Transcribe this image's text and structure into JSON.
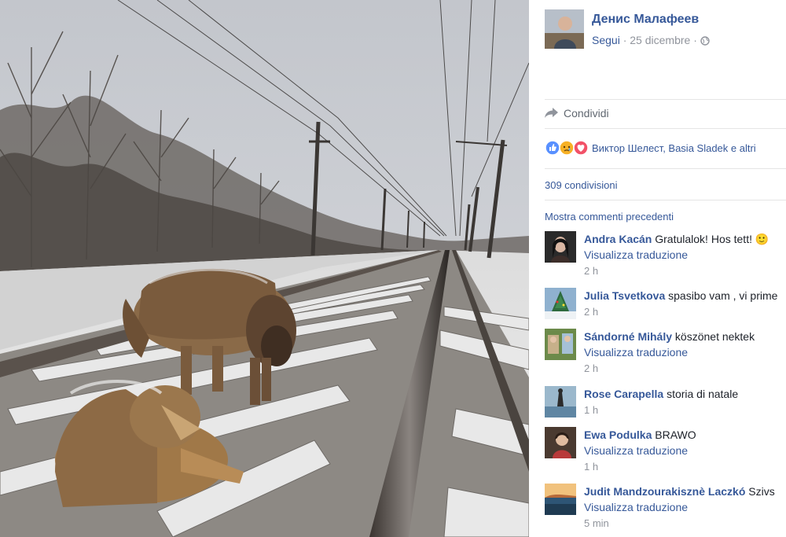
{
  "post": {
    "author_name": "Денис Малафеев",
    "follow_label": "Segui",
    "dot": "·",
    "date": "25 dicembre",
    "share_label": "Condividi",
    "reactions_text": "Виктор Шелест, Basia Sladek e altri",
    "shares_text": "309 condivisioni",
    "show_previous_comments": "Mostra commenti precedenti",
    "icons": {
      "globe": "globe-icon",
      "share": "share-arrow-icon",
      "like": "like-reaction-icon",
      "sad": "sad-reaction-icon",
      "love": "love-reaction-icon"
    }
  },
  "comments": [
    {
      "name": "Andra Kacán",
      "text": "Gratulalok! Hos tett! 🙂",
      "translate": "Visualizza traduzione",
      "time": "2 h"
    },
    {
      "name": "Julia Tsvetkova",
      "text": "spasibo vam , vi prime",
      "translate": "",
      "time": "2 h"
    },
    {
      "name": "Sándorné Mihály",
      "text": "köszönet nektek",
      "translate": "Visualizza traduzione",
      "time": "2 h"
    },
    {
      "name": "Rose Carapella",
      "text": "storia di natale",
      "translate": "",
      "time": "1 h"
    },
    {
      "name": "Ewa Podulka",
      "text": "BRAWO",
      "translate": "Visualizza traduzione",
      "time": "1 h"
    },
    {
      "name": "Judit Mandzourakisznè Laczkó",
      "text": "Szivs",
      "translate": "Visualizza traduzione",
      "time": "5 min"
    }
  ],
  "colors": {
    "link": "#365899",
    "meta": "#90949c",
    "text": "#1d2129",
    "like": "#5890ff",
    "sad": "#f7b125",
    "love": "#f25268"
  }
}
